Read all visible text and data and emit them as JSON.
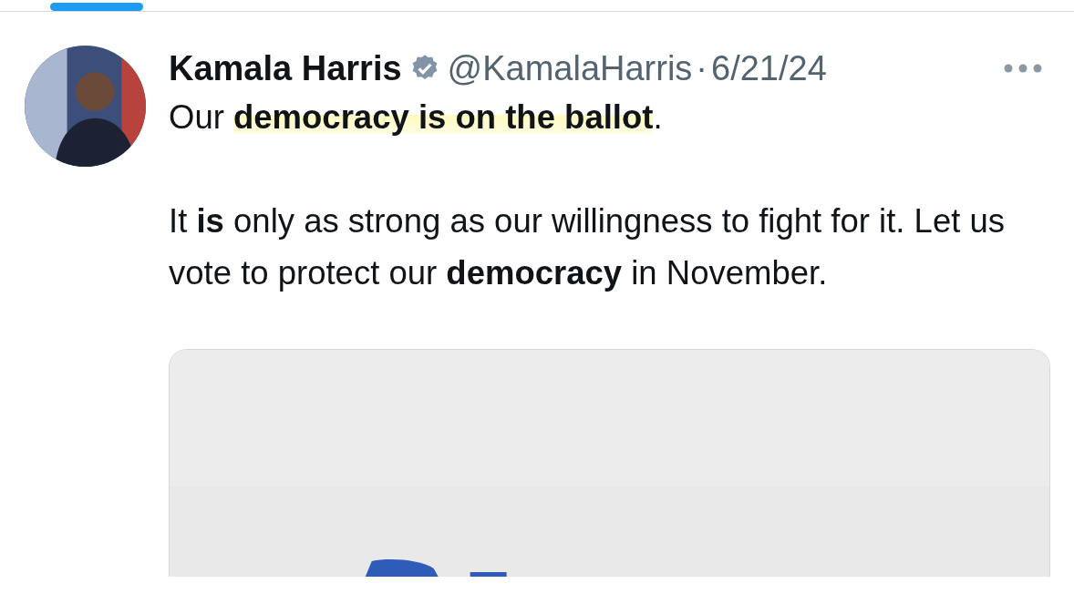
{
  "tab_indicator": {
    "selected": true
  },
  "tweet": {
    "author": "Kamala Harris",
    "verified": true,
    "handle": "@KamalaHarris",
    "separator": "·",
    "date": "6/21/24",
    "paragraphs": [
      {
        "text": "Our **democracy is on the ballot**.",
        "highlighted": true
      },
      {
        "text": "It **is** only as strong as our willingness to fight for it. Let us vote to protect our **democracy** in November.",
        "highlighted": false
      }
    ]
  }
}
